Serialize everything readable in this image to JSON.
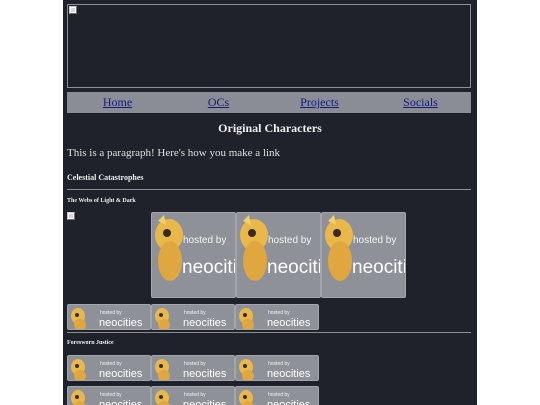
{
  "nav": {
    "items": [
      {
        "label": "Home"
      },
      {
        "label": "OCs"
      },
      {
        "label": "Projects"
      },
      {
        "label": "Socials"
      }
    ]
  },
  "main": {
    "title": "Original Characters",
    "intro": "This is a paragraph! Here's how you make a link"
  },
  "sections": {
    "celestial": {
      "heading": "Celestial Catastrophes",
      "sub_webs": "The Webs of Light & Dark"
    },
    "foresworn": {
      "heading": "Foresworn Justice"
    }
  },
  "badge": {
    "line1": "hosted by",
    "line2": "neocities"
  },
  "colors": {
    "background": "#1f222a",
    "nav_bar": "#8a8d95",
    "link": "#1a1a7d",
    "badge_bg": "#8e9198"
  }
}
